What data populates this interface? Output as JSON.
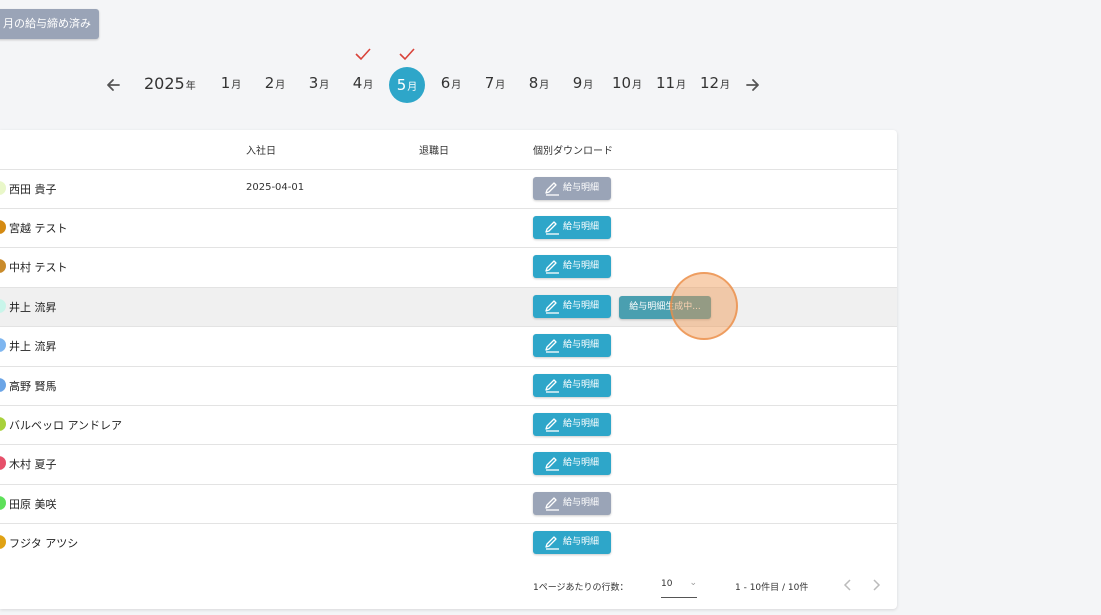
{
  "header": {
    "close_button": "月の給与締め済み"
  },
  "calendar": {
    "year": "2025",
    "year_suffix": "年",
    "month_suffix": "月",
    "months": [
      "1",
      "2",
      "3",
      "4",
      "5",
      "6",
      "7",
      "8",
      "9",
      "10",
      "11",
      "12"
    ],
    "selected_month": "5",
    "checked_months": [
      "4",
      "5"
    ]
  },
  "table": {
    "headers": {
      "hire_date": "入社日",
      "leave_date": "退職日",
      "download": "個別ダウンロード"
    },
    "rows": [
      {
        "name": "西田 貴子",
        "hire_date": "2025-04-01",
        "button": "給与明細",
        "avatar_color": "#e9f7c9",
        "button_state": "disabled"
      },
      {
        "name": "宮越 テスト",
        "hire_date": "",
        "button": "給与明細",
        "avatar_color": "#d48a12",
        "button_state": "active"
      },
      {
        "name": "中村 テスト",
        "hire_date": "",
        "button": "給与明細",
        "avatar_color": "#c98b2b",
        "button_state": "active"
      },
      {
        "name": "井上 流昇",
        "hire_date": "",
        "button": "給与明細",
        "avatar_color": "#c9f5ea",
        "button_state": "active"
      },
      {
        "name": "井上 流昇",
        "hire_date": "",
        "button": "給与明細",
        "avatar_color": "#7eb6f0",
        "button_state": "active"
      },
      {
        "name": "高野 賢馬",
        "hire_date": "",
        "button": "給与明細",
        "avatar_color": "#6aa4e6",
        "button_state": "active"
      },
      {
        "name": "バルベッロ アンドレア",
        "hire_date": "",
        "button": "給与明細",
        "avatar_color": "#a8d13a",
        "button_state": "active"
      },
      {
        "name": "木村 夏子",
        "hire_date": "",
        "button": "給与明細",
        "avatar_color": "#e6506a",
        "button_state": "active"
      },
      {
        "name": "田原 美咲",
        "hire_date": "",
        "button": "給与明細",
        "avatar_color": "#5ee05a",
        "button_state": "disabled"
      },
      {
        "name": "フジタ アツシ",
        "hire_date": "",
        "button": "給与明細",
        "avatar_color": "#e0a214",
        "button_state": "active"
      }
    ],
    "generating_label": "給与明細生成中..."
  },
  "pagination": {
    "rows_per_page_label": "1ページあたりの行数：",
    "rows_per_page": "10",
    "range": "1 - 10件目 / 10件"
  },
  "colors": {
    "accent": "#2ea6c9",
    "disabled": "#9aa4b7",
    "check": "#d9433a"
  }
}
